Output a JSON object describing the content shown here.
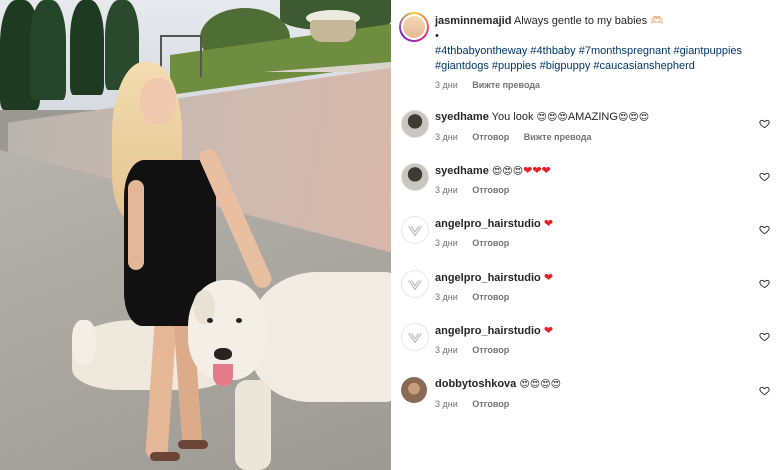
{
  "post": {
    "username": "jasminnemajid",
    "caption": "Always gentle to my babies 🫶🏻",
    "bullet": "•",
    "hashtags_line1": "#4thbabyontheway #4thbaby #7monthspregnant #giantpuppies",
    "hashtags_line2": "#giantdogs #puppies #bigpuppy #caucasianshepherd",
    "time": "3 дни",
    "see_translation": "Вижте превода"
  },
  "comments": [
    {
      "username": "syedhame",
      "text_prefix": "You look ",
      "emoji_a": "😍😍😍",
      "text_mid": "AMAZING",
      "emoji_b": "😍😍😍",
      "time": "3 дни",
      "reply": "Отговор",
      "see_translation": "Вижте превода",
      "avatar_icon": "dog-avatar-icon"
    },
    {
      "username": "syedhame",
      "emoji_a": "😍😍😍",
      "hearts": "❤❤❤",
      "time": "3 дни",
      "reply": "Отговор",
      "avatar_icon": "dog-avatar-icon"
    },
    {
      "username": "angelpro_hairstudio",
      "hearts": "❤",
      "time": "3 дни",
      "reply": "Отговор",
      "avatar_icon": "logo-avatar-icon"
    },
    {
      "username": "angelpro_hairstudio",
      "hearts": "❤",
      "time": "3 дни",
      "reply": "Отговор",
      "avatar_icon": "logo-avatar-icon"
    },
    {
      "username": "angelpro_hairstudio",
      "hearts": "❤",
      "time": "3 дни",
      "reply": "Отговор",
      "avatar_icon": "logo-avatar-icon"
    },
    {
      "username": "dobbytoshkova",
      "emoji_a": "😍😍😍😍",
      "time": "3 дни",
      "reply": "Отговор",
      "avatar_icon": "person-avatar-icon"
    }
  ],
  "colors": {
    "link": "#00376b",
    "muted": "#737373",
    "heart_red": "#ed1c24"
  }
}
